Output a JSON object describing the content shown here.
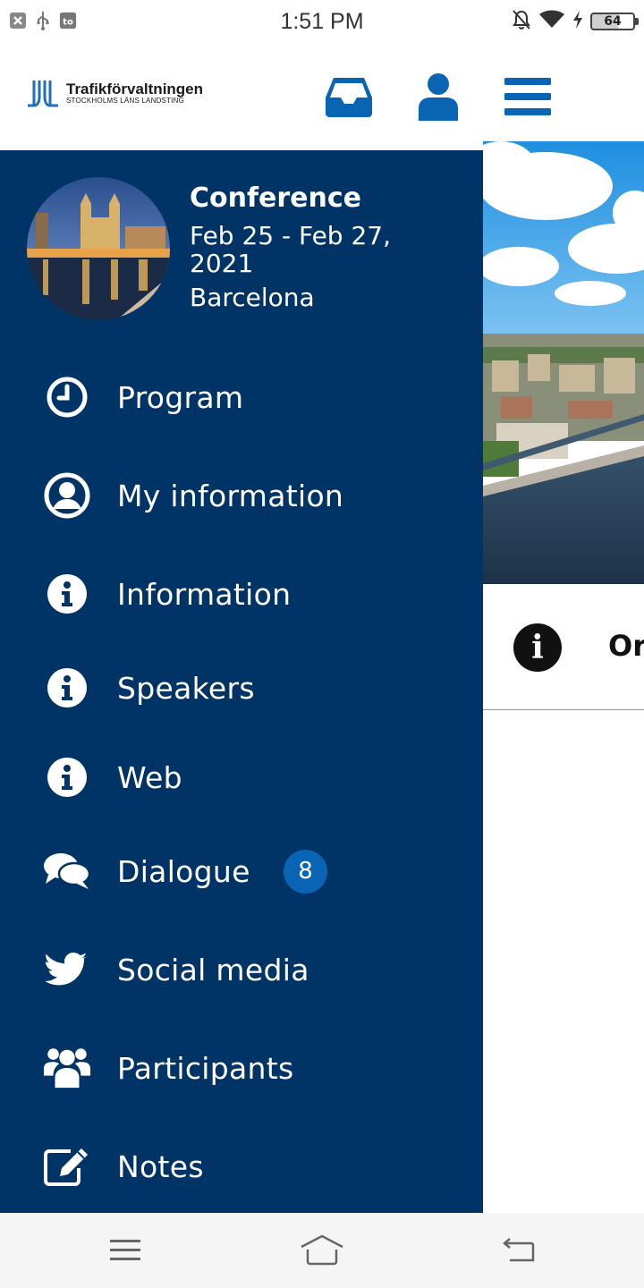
{
  "status_bar": {
    "time": "1:51 PM",
    "battery_level": "64",
    "left_icons": [
      "close-box-icon",
      "usb-icon",
      "tor-icon"
    ],
    "right_icons": [
      "bell-off-icon",
      "wifi-icon",
      "charging-icon",
      "battery-icon"
    ]
  },
  "header": {
    "logo": {
      "name": "Trafikförvaltningen",
      "subtitle": "STOCKHOLMS LÄNS LANDSTING"
    },
    "actions": [
      "inbox-icon",
      "user-icon",
      "hamburger-menu-icon"
    ],
    "accent_color": "#0a64b4"
  },
  "drawer": {
    "background_color": "#003366",
    "event": {
      "title": "Conference",
      "dates": "Feb 25 - Feb 27, 2021",
      "location": "Barcelona"
    },
    "menu": [
      {
        "label": "Program",
        "icon": "clock-icon"
      },
      {
        "label": "My information",
        "icon": "user-circle-icon"
      },
      {
        "label": "Information",
        "icon": "info-icon"
      },
      {
        "label": "Speakers",
        "icon": "info-icon"
      },
      {
        "label": "Web",
        "icon": "info-icon"
      },
      {
        "label": "Dialogue",
        "icon": "chat-bubbles-icon",
        "badge": "8"
      },
      {
        "label": "Social media",
        "icon": "twitter-icon"
      },
      {
        "label": "Participants",
        "icon": "users-icon"
      },
      {
        "label": "Notes",
        "icon": "edit-icon"
      }
    ]
  },
  "background_content": {
    "info_text": "Or"
  },
  "nav_bar": {
    "buttons": [
      "menu-icon",
      "home-icon",
      "back-icon"
    ]
  }
}
